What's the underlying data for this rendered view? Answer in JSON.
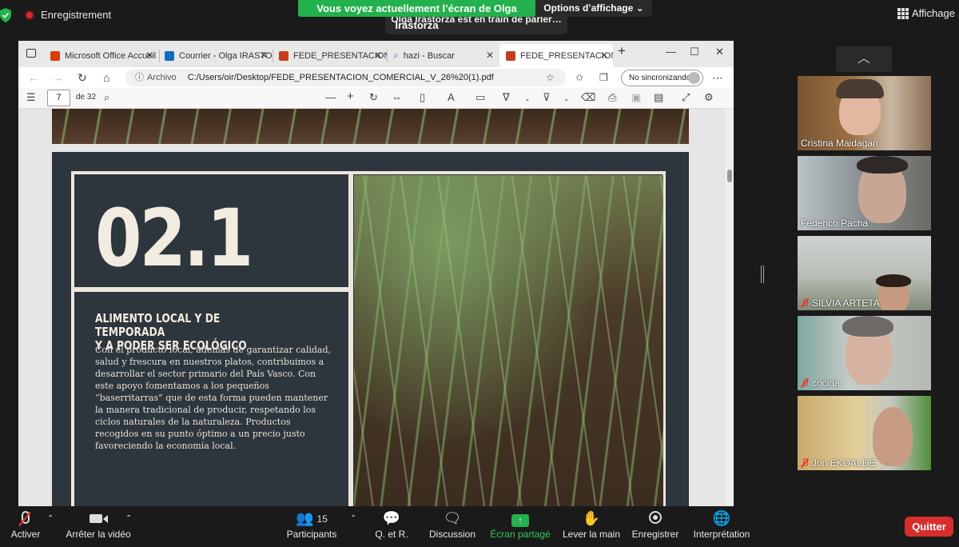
{
  "zoom": {
    "recording_label": "Enregistrement",
    "share_banner": "Vous voyez actuellement l’écran de Olga Irastorza",
    "view_options": "Options d’affichage ⌄",
    "speaking_banner": "Olga Irastorza est en train de parler…",
    "view_button": "Affichage",
    "quit_button": "Quitter",
    "participants_count": "15",
    "toolbar": [
      {
        "name": "mute",
        "label": "Activer"
      },
      {
        "name": "video",
        "label": "Arrêter la vidéo"
      },
      {
        "name": "participants",
        "label": "Participants"
      },
      {
        "name": "qa",
        "label": "Q. et R."
      },
      {
        "name": "chat",
        "label": "Discussion"
      },
      {
        "name": "share",
        "label": "Écran partagé"
      },
      {
        "name": "raise-hand",
        "label": "Lever la main"
      },
      {
        "name": "record",
        "label": "Enregistrer"
      },
      {
        "name": "interpretation",
        "label": "Interprétation"
      }
    ],
    "participants": [
      {
        "name": "Cristina Maidagan",
        "muted": false
      },
      {
        "name": "Federico Pacha",
        "muted": false
      },
      {
        "name": "SILVIA ARTETA",
        "muted": true
      },
      {
        "name": "cocina",
        "muted": true
      },
      {
        "name": "Jon EKOALDE",
        "muted": true
      }
    ]
  },
  "browser": {
    "tabs": [
      {
        "label": "Microsoft Office Accueil",
        "icon": "office-icon",
        "color": "#d83b01"
      },
      {
        "label": "Courrier - Olga IRASTORZ",
        "icon": "outlook-icon",
        "color": "#0f6cbd"
      },
      {
        "label": "FEDE_PRESENTACION_CO",
        "icon": "pdf-icon",
        "color": "#c43e1c"
      },
      {
        "label": "hazi - Buscar",
        "icon": "search-icon",
        "color": "#2f6bd6"
      },
      {
        "label": "FEDE_PRESENTACION_CO",
        "icon": "pdf-icon",
        "color": "#c43e1c"
      }
    ],
    "address_prefix": "Archivo",
    "address": "C:/Users/oir/Desktop/FEDE_PRESENTACION_COMERCIAL_V_26%20(1).pdf",
    "sync_label": "No sincronizando",
    "pdf": {
      "page": "7",
      "page_of": "de 32"
    }
  },
  "slide": {
    "number": "02.1",
    "heading_line1": "ALIMENTO LOCAL Y DE TEMPORADA",
    "heading_line2": "Y A PODER SER ECOLÓGICO",
    "body": "Con el producto local, además de garantizar calidad, salud y frescura en nuestros platos, contribuimos a desarrollar el sector primario del País Vasco. Con este apoyo fomentamos a los pequeños “baserritarras” que de esta forma pueden mantener la manera tradicional de producir, respetando los ciclos naturales de la naturaleza. Productos recogidos en su punto óptimo a un precio justo favoreciendo la economía local."
  }
}
